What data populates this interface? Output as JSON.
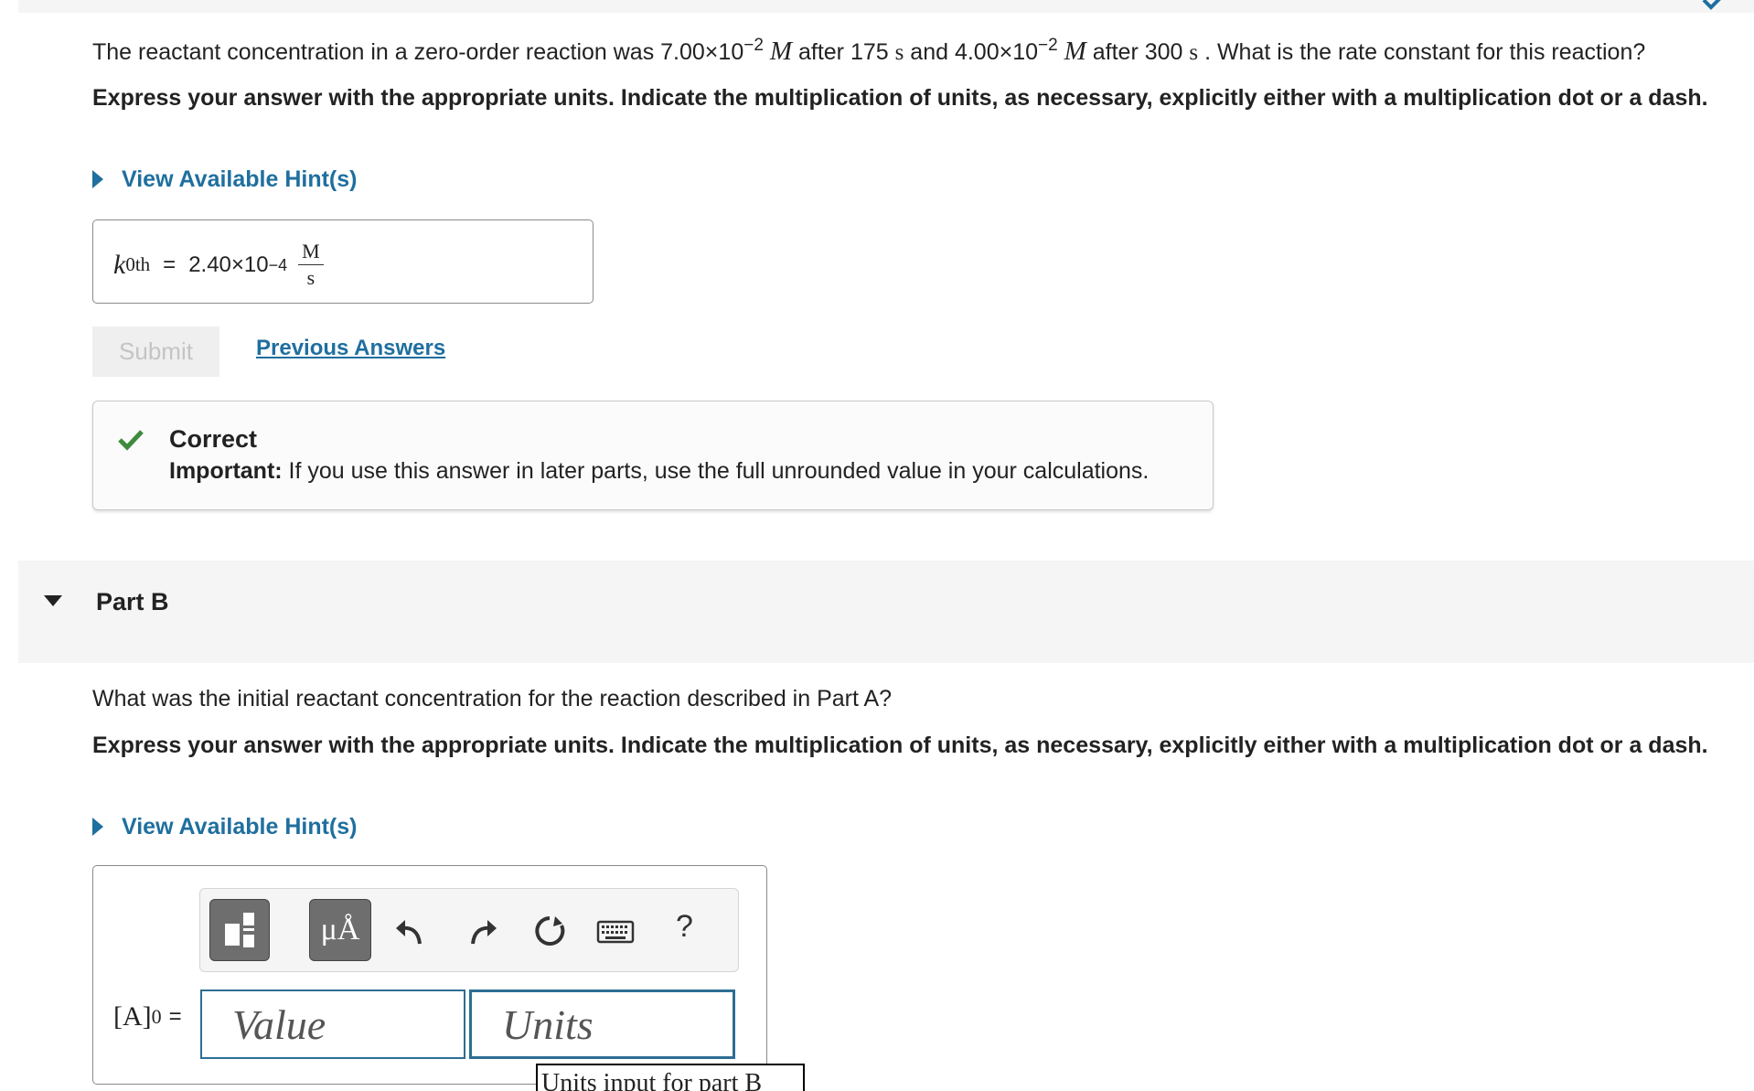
{
  "colors": {
    "link": "#1f6f9f",
    "correct_green": "#3d8b3d",
    "input_border": "#2d6e94"
  },
  "part_a": {
    "question": {
      "before": "The reactant concentration in a zero-order reaction was 7.00×10",
      "exp1": "−2",
      "unit1": "M",
      "mid1": " after 175 ",
      "s1": "s",
      "mid2": " and 4.00×10",
      "exp2": "−2",
      "unit2": "M",
      "mid3": " after 300 ",
      "s2": "s",
      "after": " . What is the rate constant for this reaction?"
    },
    "instruction": "Express your answer with the appropriate units. Indicate the multiplication of units, as necessary, explicitly either with a multiplication dot or a dash.",
    "hint_label": "View Available Hint(s)",
    "answer": {
      "var": "k",
      "sub": "0th",
      "equals": "=",
      "mantissa": "2.40×10",
      "exponent": "−4",
      "unit_num": "M",
      "unit_den": "s"
    },
    "submit_label": "Submit",
    "previous_answers_label": "Previous Answers",
    "feedback": {
      "title": "Correct",
      "important_label": "Important:",
      "message": " If you use this answer in later parts, use the full unrounded value in your calculations."
    }
  },
  "part_b": {
    "title": "Part B",
    "question": "What was the initial reactant concentration for the reaction described in Part A?",
    "instruction": "Express your answer with the appropriate units. Indicate the multiplication of units, as necessary, explicitly either with a multiplication dot or a dash.",
    "hint_label": "View Available Hint(s)",
    "toolbar": {
      "symbols_label": "μÅ",
      "help_label": "?"
    },
    "lhs": {
      "base": "[A]",
      "sub": "0",
      "equals": "="
    },
    "value_placeholder": "Value",
    "units_placeholder": "Units",
    "tooltip": "Units input for part B"
  }
}
